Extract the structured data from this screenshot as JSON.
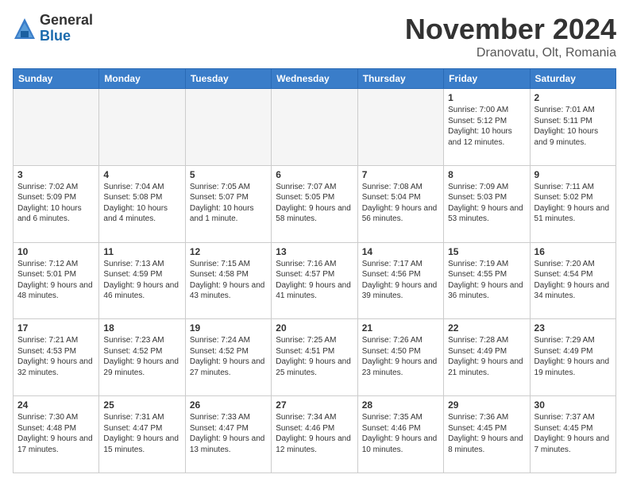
{
  "logo": {
    "general": "General",
    "blue": "Blue"
  },
  "header": {
    "month": "November 2024",
    "location": "Dranovatu, Olt, Romania"
  },
  "weekdays": [
    "Sunday",
    "Monday",
    "Tuesday",
    "Wednesday",
    "Thursday",
    "Friday",
    "Saturday"
  ],
  "weeks": [
    [
      {
        "day": "",
        "info": "",
        "empty": true
      },
      {
        "day": "",
        "info": "",
        "empty": true
      },
      {
        "day": "",
        "info": "",
        "empty": true
      },
      {
        "day": "",
        "info": "",
        "empty": true
      },
      {
        "day": "",
        "info": "",
        "empty": true
      },
      {
        "day": "1",
        "info": "Sunrise: 7:00 AM\nSunset: 5:12 PM\nDaylight: 10 hours and 12 minutes.",
        "empty": false
      },
      {
        "day": "2",
        "info": "Sunrise: 7:01 AM\nSunset: 5:11 PM\nDaylight: 10 hours and 9 minutes.",
        "empty": false
      }
    ],
    [
      {
        "day": "3",
        "info": "Sunrise: 7:02 AM\nSunset: 5:09 PM\nDaylight: 10 hours and 6 minutes.",
        "empty": false
      },
      {
        "day": "4",
        "info": "Sunrise: 7:04 AM\nSunset: 5:08 PM\nDaylight: 10 hours and 4 minutes.",
        "empty": false
      },
      {
        "day": "5",
        "info": "Sunrise: 7:05 AM\nSunset: 5:07 PM\nDaylight: 10 hours and 1 minute.",
        "empty": false
      },
      {
        "day": "6",
        "info": "Sunrise: 7:07 AM\nSunset: 5:05 PM\nDaylight: 9 hours and 58 minutes.",
        "empty": false
      },
      {
        "day": "7",
        "info": "Sunrise: 7:08 AM\nSunset: 5:04 PM\nDaylight: 9 hours and 56 minutes.",
        "empty": false
      },
      {
        "day": "8",
        "info": "Sunrise: 7:09 AM\nSunset: 5:03 PM\nDaylight: 9 hours and 53 minutes.",
        "empty": false
      },
      {
        "day": "9",
        "info": "Sunrise: 7:11 AM\nSunset: 5:02 PM\nDaylight: 9 hours and 51 minutes.",
        "empty": false
      }
    ],
    [
      {
        "day": "10",
        "info": "Sunrise: 7:12 AM\nSunset: 5:01 PM\nDaylight: 9 hours and 48 minutes.",
        "empty": false
      },
      {
        "day": "11",
        "info": "Sunrise: 7:13 AM\nSunset: 4:59 PM\nDaylight: 9 hours and 46 minutes.",
        "empty": false
      },
      {
        "day": "12",
        "info": "Sunrise: 7:15 AM\nSunset: 4:58 PM\nDaylight: 9 hours and 43 minutes.",
        "empty": false
      },
      {
        "day": "13",
        "info": "Sunrise: 7:16 AM\nSunset: 4:57 PM\nDaylight: 9 hours and 41 minutes.",
        "empty": false
      },
      {
        "day": "14",
        "info": "Sunrise: 7:17 AM\nSunset: 4:56 PM\nDaylight: 9 hours and 39 minutes.",
        "empty": false
      },
      {
        "day": "15",
        "info": "Sunrise: 7:19 AM\nSunset: 4:55 PM\nDaylight: 9 hours and 36 minutes.",
        "empty": false
      },
      {
        "day": "16",
        "info": "Sunrise: 7:20 AM\nSunset: 4:54 PM\nDaylight: 9 hours and 34 minutes.",
        "empty": false
      }
    ],
    [
      {
        "day": "17",
        "info": "Sunrise: 7:21 AM\nSunset: 4:53 PM\nDaylight: 9 hours and 32 minutes.",
        "empty": false
      },
      {
        "day": "18",
        "info": "Sunrise: 7:23 AM\nSunset: 4:52 PM\nDaylight: 9 hours and 29 minutes.",
        "empty": false
      },
      {
        "day": "19",
        "info": "Sunrise: 7:24 AM\nSunset: 4:52 PM\nDaylight: 9 hours and 27 minutes.",
        "empty": false
      },
      {
        "day": "20",
        "info": "Sunrise: 7:25 AM\nSunset: 4:51 PM\nDaylight: 9 hours and 25 minutes.",
        "empty": false
      },
      {
        "day": "21",
        "info": "Sunrise: 7:26 AM\nSunset: 4:50 PM\nDaylight: 9 hours and 23 minutes.",
        "empty": false
      },
      {
        "day": "22",
        "info": "Sunrise: 7:28 AM\nSunset: 4:49 PM\nDaylight: 9 hours and 21 minutes.",
        "empty": false
      },
      {
        "day": "23",
        "info": "Sunrise: 7:29 AM\nSunset: 4:49 PM\nDaylight: 9 hours and 19 minutes.",
        "empty": false
      }
    ],
    [
      {
        "day": "24",
        "info": "Sunrise: 7:30 AM\nSunset: 4:48 PM\nDaylight: 9 hours and 17 minutes.",
        "empty": false
      },
      {
        "day": "25",
        "info": "Sunrise: 7:31 AM\nSunset: 4:47 PM\nDaylight: 9 hours and 15 minutes.",
        "empty": false
      },
      {
        "day": "26",
        "info": "Sunrise: 7:33 AM\nSunset: 4:47 PM\nDaylight: 9 hours and 13 minutes.",
        "empty": false
      },
      {
        "day": "27",
        "info": "Sunrise: 7:34 AM\nSunset: 4:46 PM\nDaylight: 9 hours and 12 minutes.",
        "empty": false
      },
      {
        "day": "28",
        "info": "Sunrise: 7:35 AM\nSunset: 4:46 PM\nDaylight: 9 hours and 10 minutes.",
        "empty": false
      },
      {
        "day": "29",
        "info": "Sunrise: 7:36 AM\nSunset: 4:45 PM\nDaylight: 9 hours and 8 minutes.",
        "empty": false
      },
      {
        "day": "30",
        "info": "Sunrise: 7:37 AM\nSunset: 4:45 PM\nDaylight: 9 hours and 7 minutes.",
        "empty": false
      }
    ]
  ]
}
